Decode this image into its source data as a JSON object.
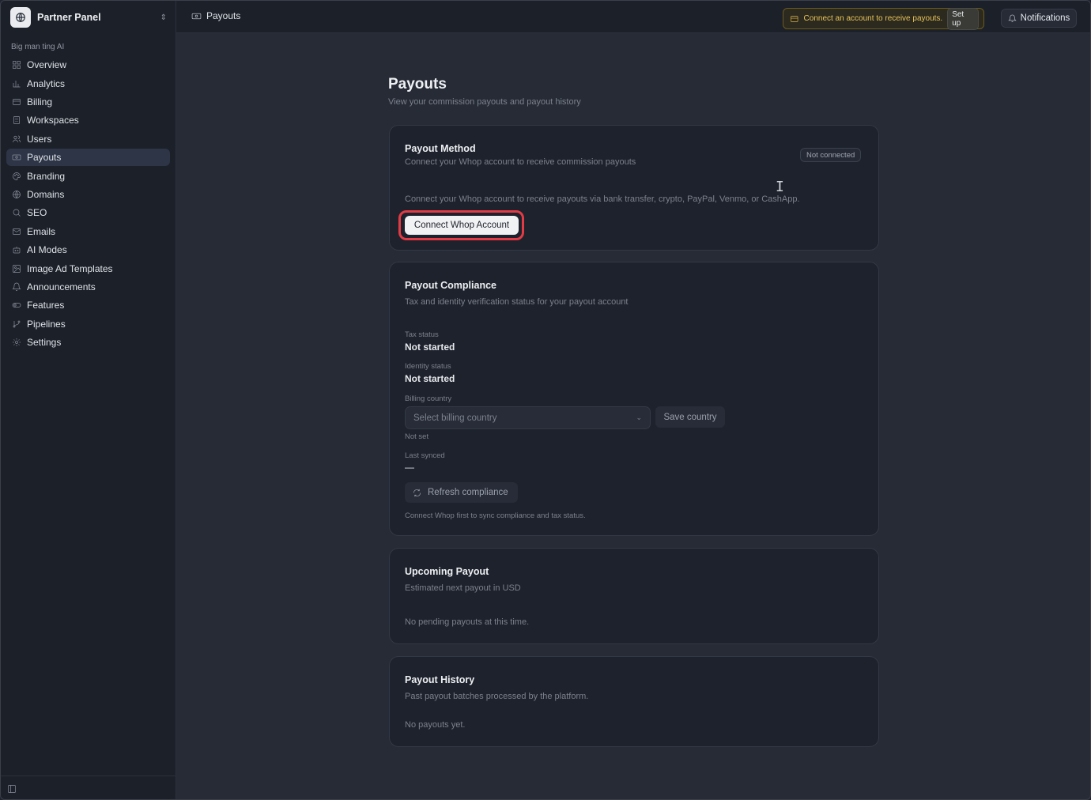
{
  "sidebar": {
    "brand_name": "Partner Panel",
    "workspace_label": "Big man ting AI",
    "items": [
      {
        "label": "Overview",
        "icon": "grid-icon"
      },
      {
        "label": "Analytics",
        "icon": "bar-chart-icon"
      },
      {
        "label": "Billing",
        "icon": "credit-card-icon"
      },
      {
        "label": "Workspaces",
        "icon": "building-icon"
      },
      {
        "label": "Users",
        "icon": "users-icon"
      },
      {
        "label": "Payouts",
        "icon": "banknote-icon",
        "active": true
      },
      {
        "label": "Branding",
        "icon": "palette-icon"
      },
      {
        "label": "Domains",
        "icon": "globe-icon"
      },
      {
        "label": "SEO",
        "icon": "search-icon"
      },
      {
        "label": "Emails",
        "icon": "mail-icon"
      },
      {
        "label": "AI Modes",
        "icon": "bot-icon"
      },
      {
        "label": "Image Ad Templates",
        "icon": "image-icon"
      },
      {
        "label": "Announcements",
        "icon": "bell-icon"
      },
      {
        "label": "Features",
        "icon": "toggle-icon"
      },
      {
        "label": "Pipelines",
        "icon": "git-branch-icon"
      },
      {
        "label": "Settings",
        "icon": "gear-icon"
      }
    ]
  },
  "topbar": {
    "breadcrumb": "Payouts",
    "alert_text": "Connect an account to receive payouts.",
    "alert_button": "Set up",
    "notifications_label": "Notifications"
  },
  "page": {
    "title": "Payouts",
    "subtitle": "View your commission payouts and payout history"
  },
  "payout_method": {
    "title": "Payout Method",
    "description": "Connect your Whop account to receive commission payouts",
    "status_badge": "Not connected",
    "info": "Connect your Whop account to receive payouts via bank transfer, crypto, PayPal, Venmo, or CashApp.",
    "connect_button": "Connect Whop Account"
  },
  "compliance": {
    "title": "Payout Compliance",
    "description": "Tax and identity verification status for your payout account",
    "tax_label": "Tax status",
    "tax_value": "Not started",
    "identity_label": "Identity status",
    "identity_value": "Not started",
    "country_label": "Billing country",
    "country_placeholder": "Select billing country",
    "save_button": "Save country",
    "country_status": "Not set",
    "synced_label": "Last synced",
    "synced_value": "—",
    "refresh_button": "Refresh compliance",
    "hint": "Connect Whop first to sync compliance and tax status."
  },
  "upcoming": {
    "title": "Upcoming Payout",
    "description": "Estimated next payout in USD",
    "empty": "No pending payouts at this time."
  },
  "history": {
    "title": "Payout History",
    "description": "Past payout batches processed by the platform.",
    "empty": "No payouts yet."
  },
  "colors": {
    "background": "#262b36",
    "sidebar": "#1c2029",
    "card": "#1e222c",
    "active_nav": "#2e3547",
    "alert_accent": "#e8c35a",
    "highlight": "#e23b45"
  }
}
